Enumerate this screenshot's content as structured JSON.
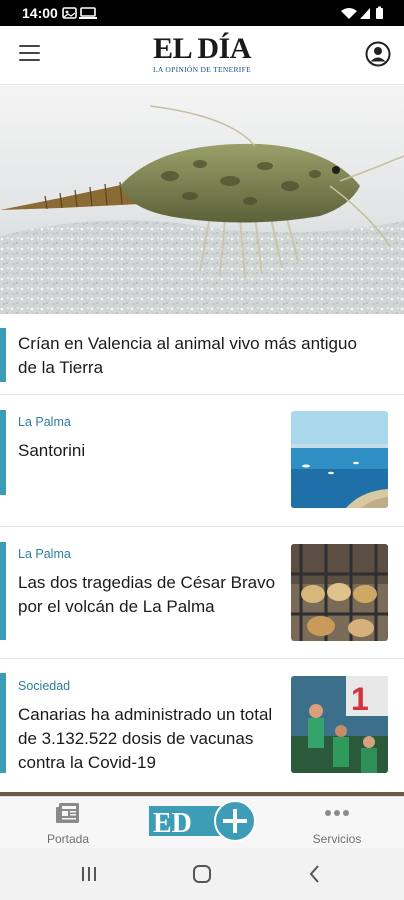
{
  "status_bar": {
    "time": "14:00"
  },
  "header": {
    "logo_title": "EL DÍA",
    "logo_subtitle": "LA OPINIÓN DE TENERIFE"
  },
  "articles": [
    {
      "section": "",
      "headline": "Crían en Valencia al animal vivo más antiguo de la Tierra"
    },
    {
      "section": "La Palma",
      "headline": "Santorini"
    },
    {
      "section": "La Palma",
      "headline": "Las dos tragedias de César Bravo por el volcán de La Palma"
    },
    {
      "section": "Sociedad",
      "headline": "Canarias ha administrado un total de 3.132.522 dosis de vacunas contra la Covid-19"
    }
  ],
  "bottom_nav": {
    "portada": "Portada",
    "center_logo_text": "ED",
    "servicios": "Servicios"
  },
  "colors": {
    "accent": "#3a9cb5",
    "section_text": "#2d7f9b"
  }
}
